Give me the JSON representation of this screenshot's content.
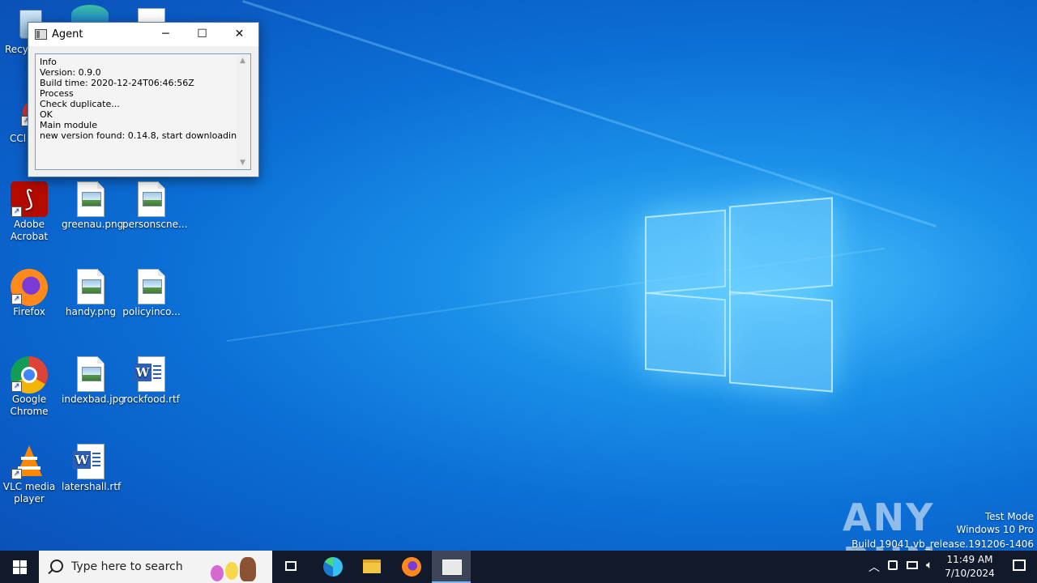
{
  "desktop": {
    "icons": [
      {
        "label": "Recy"
      },
      {
        "label": "CCl"
      },
      {
        "label": "Adobe Acrobat"
      },
      {
        "label": "greenau.png"
      },
      {
        "label": "personscne..."
      },
      {
        "label": "Firefox"
      },
      {
        "label": "handy.png"
      },
      {
        "label": "policyinco..."
      },
      {
        "label": "Google Chrome"
      },
      {
        "label": "indexbad.jpg"
      },
      {
        "label": "rockfood.rtf"
      },
      {
        "label": "VLC media player"
      },
      {
        "label": "latershall.rtf"
      }
    ]
  },
  "agent_window": {
    "title": "Agent",
    "log_text": "Info\nVersion: 0.9.0\nBuild time: 2020-12-24T06:46:56Z\nProcess\nCheck duplicate...\nOK\nMain module\nnew version found: 0.14.8, start downloading..."
  },
  "watermark": {
    "logo": "ANY RUN",
    "line1": "Test Mode",
    "line2": "Windows 10 Pro",
    "line3": "Build 19041.vb_release.191206-1406"
  },
  "taskbar": {
    "search_placeholder": "Type here to search",
    "time": "11:49 AM",
    "date": "7/10/2024"
  },
  "colors": {
    "taskbar_bg": "#101a2a",
    "desktop_accent": "#0b6fd6"
  }
}
